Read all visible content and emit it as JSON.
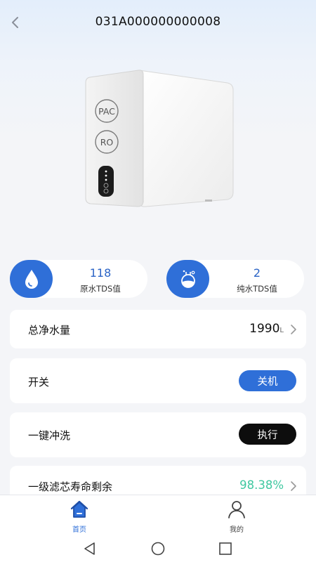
{
  "header": {
    "title": "031A000000000008"
  },
  "device": {
    "badge_pac": "PAC",
    "badge_ro": "RO"
  },
  "tds": {
    "raw": {
      "value": "118",
      "label": "原水TDS值"
    },
    "pure": {
      "value": "2",
      "label": "纯水TDS值"
    }
  },
  "total_water": {
    "label": "总净水量",
    "value": "1990",
    "unit": "L"
  },
  "power": {
    "label": "开关",
    "button": "关机"
  },
  "flush": {
    "label": "一键冲洗",
    "button": "执行"
  },
  "filter": {
    "label": "一级滤芯寿命剩余",
    "value": "98.38%",
    "color": "#3fc8a0"
  },
  "tabs": [
    {
      "label": "首页",
      "active": true
    },
    {
      "label": "我的",
      "active": false
    }
  ],
  "colors": {
    "accent": "#2f6fd8",
    "dark": "#0d0d0d"
  }
}
